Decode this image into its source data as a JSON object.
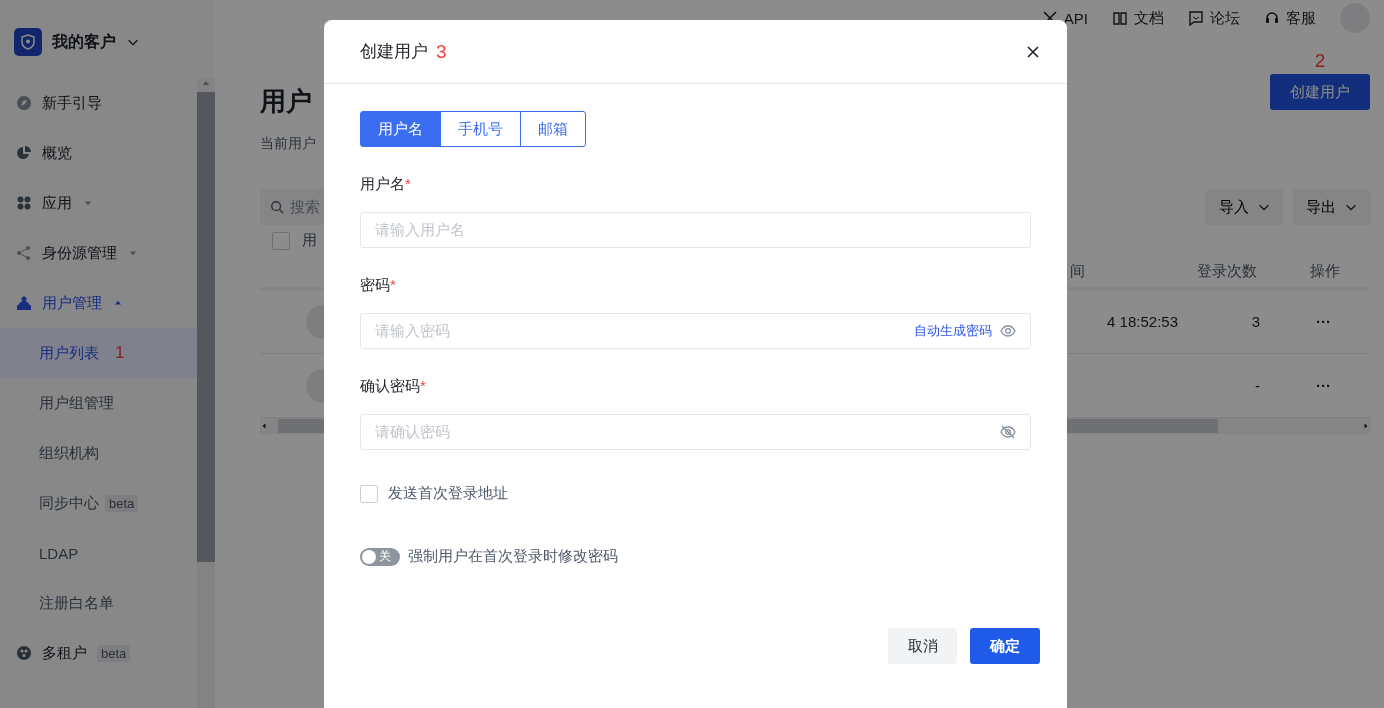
{
  "sidebar": {
    "org": "我的客户",
    "items": [
      {
        "label": "新手引导",
        "active": false
      },
      {
        "label": "概览",
        "active": false
      },
      {
        "label": "应用",
        "active": false,
        "expanded": false
      },
      {
        "label": "身份源管理",
        "active": false,
        "expanded": false
      },
      {
        "label": "用户管理",
        "active": true,
        "expanded": true,
        "children": [
          {
            "label": "用户列表",
            "selected": true,
            "annotation": "1"
          },
          {
            "label": "用户组管理",
            "selected": false
          },
          {
            "label": "组织机构",
            "selected": false
          },
          {
            "label": "同步中心",
            "selected": false,
            "badge": "beta"
          },
          {
            "label": "LDAP",
            "selected": false
          },
          {
            "label": "注册白名单",
            "selected": false
          }
        ]
      },
      {
        "label": "多租户",
        "active": false,
        "badge": "beta"
      }
    ]
  },
  "topbar": {
    "links": [
      {
        "label": "API"
      },
      {
        "label": "文档"
      },
      {
        "label": "论坛"
      },
      {
        "label": "客服"
      }
    ]
  },
  "page": {
    "title": "用户",
    "subtitle": "当前用户",
    "create_button": "创建用户",
    "annotation": "2",
    "search": {
      "placeholder": "搜索"
    },
    "import_button": "导入",
    "export_button": "导出",
    "table": {
      "select_all": {
        "checked": false
      },
      "columns": [
        "用",
        "间",
        "登录次数",
        "操作"
      ],
      "rows": [
        {
          "time": "4 18:52:53",
          "count": "3",
          "actions": "···"
        },
        {
          "time": "",
          "count": "-",
          "actions": "···"
        }
      ]
    }
  },
  "dialog": {
    "title": "创建用户",
    "annotation": "3",
    "tabs": [
      {
        "label": "用户名",
        "selected": true
      },
      {
        "label": "手机号",
        "selected": false
      },
      {
        "label": "邮箱",
        "selected": false
      }
    ],
    "fields": [
      {
        "label": "用户名",
        "required_mark": "*",
        "placeholder": "请输入用户名"
      },
      {
        "label": "密码",
        "required_mark": "*",
        "placeholder": "请输入密码",
        "action": "自动生成密码",
        "eye_crossed": false
      },
      {
        "label": "确认密码",
        "required_mark": "*",
        "placeholder": "请确认密码",
        "eye_crossed": true
      }
    ],
    "checkbox": {
      "label": "发送首次登录地址",
      "checked": false
    },
    "switch": {
      "on": false,
      "text": "关",
      "label": "强制用户在首次登录时修改密码"
    },
    "buttons": [
      {
        "label": "取消",
        "kind": "secondary"
      },
      {
        "label": "确定",
        "kind": "primary"
      }
    ]
  }
}
